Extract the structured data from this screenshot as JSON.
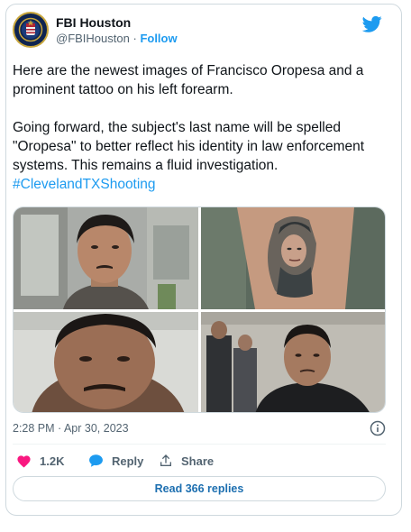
{
  "author": {
    "display_name": "FBI Houston",
    "handle": "@FBIHouston",
    "separator": "·",
    "follow_label": "Follow"
  },
  "tweet": {
    "paragraph1": "Here are the newest images of Francisco Oropesa and a prominent tattoo on his left forearm.",
    "paragraph2": "Going forward, the subject's last name will be spelled \"Oropesa\" to better reflect his identity in law enforcement systems. This remains a fluid investigation.",
    "hashtag": "#ClevelandTXShooting"
  },
  "meta": {
    "timestamp": "2:28 PM · Apr 30, 2023"
  },
  "actions": {
    "like_count": "1.2K",
    "reply_label": "Reply",
    "share_label": "Share"
  },
  "replies": {
    "label": "Read 366 replies"
  },
  "colors": {
    "accent": "#1d9bf0",
    "like": "#f91880",
    "text": "#0f1419",
    "muted": "#536471",
    "border": "#cfd9de"
  },
  "icons": [
    "fbi-seal-icon",
    "twitter-bird-icon",
    "info-icon",
    "heart-icon",
    "reply-bubble-icon",
    "share-icon"
  ]
}
